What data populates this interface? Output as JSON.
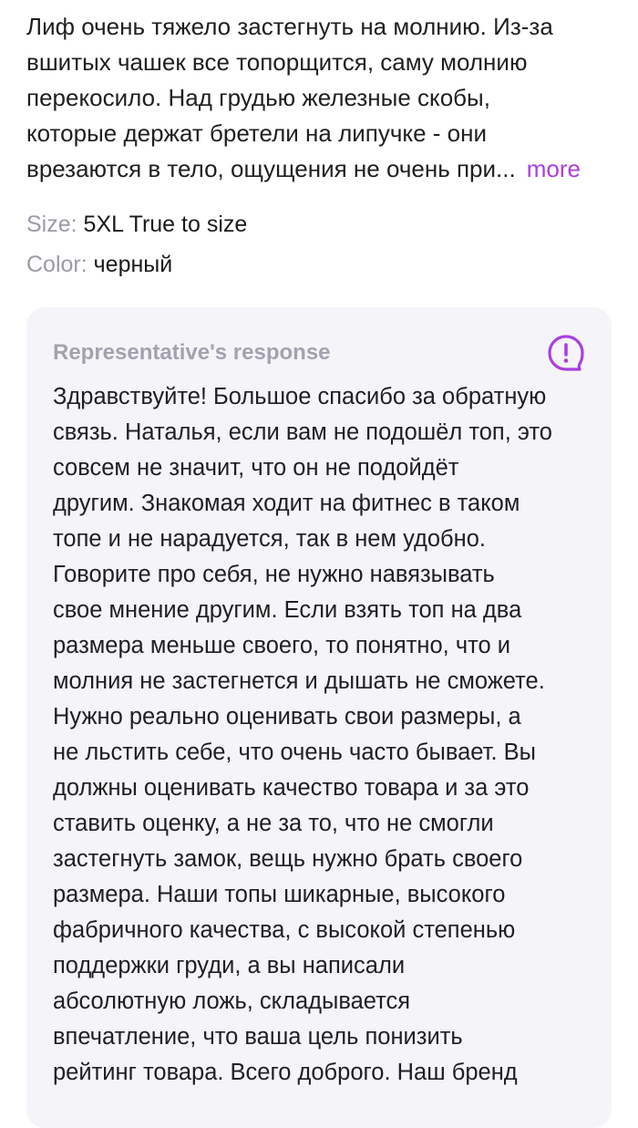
{
  "review": {
    "lines": [
      "Лиф очень тяжело застегнуть на молнию. Из-за",
      "вшитых чашек все топорщится, саму молнию",
      "перекосило. Над грудью железные скобы,",
      "которые держат бретели на липучке - они",
      "врезаются в тело, ощущения не очень при..."
    ],
    "more_label": "more",
    "size_label": "Size:",
    "size_value": "5XL True to size",
    "color_label": "Color:",
    "color_value": "черный"
  },
  "response": {
    "title": "Representative's response",
    "icon": "speech-bubble-exclamation-icon",
    "lines": [
      "Здравствуйте! Большое спасибо за обратную",
      "связь. Наталья, если вам не подошёл топ, это",
      "совсем не значит, что он не подойдёт",
      "другим. Знакомая ходит на фитнес в таком",
      "топе и не нарадуется, так в нем удобно.",
      "Говорите про себя, не нужно навязывать",
      "свое мнение другим. Если взять топ на два",
      "размера меньше своего, то понятно, что и",
      "молния не застегнется и дышать не сможете.",
      "Нужно реально оценивать свои размеры, а",
      "не льстить себе, что очень часто бывает. Вы",
      "должны оценивать качество товара и за это",
      "ставить оценку, а не за то, что не смогли",
      "застегнуть замок, вещь нужно брать своего",
      "размера. Наши топы шикарные, высокого",
      "фабричного качества, с высокой степенью",
      "поддержки груди, а вы написали",
      "абсолютную ложь, складывается",
      "впечатление, что ваша цель понизить",
      "рейтинг товара. Всего доброго. Наш бренд"
    ]
  },
  "colors": {
    "accent": "#a93fe0",
    "label_gray": "#9b9ba5",
    "card_background": "#f5f4f9"
  }
}
